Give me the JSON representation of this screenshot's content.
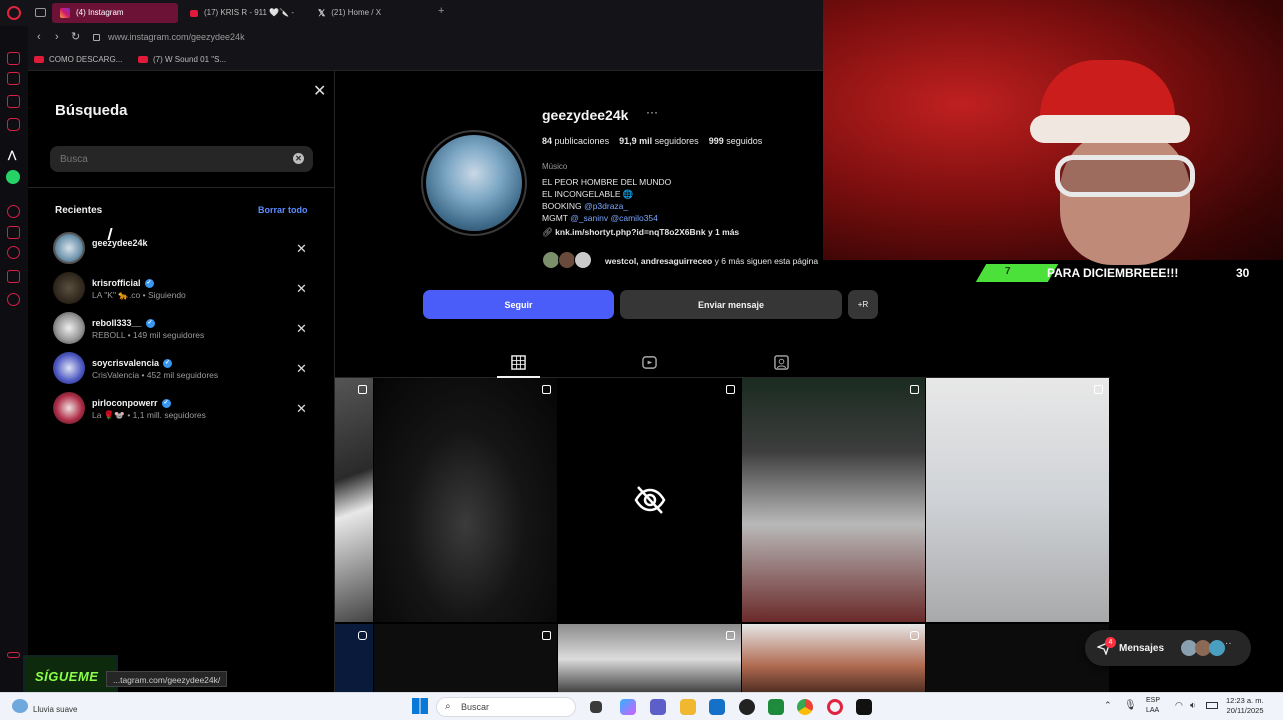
{
  "browser": {
    "tabs": [
      {
        "label": "(4) Instagram",
        "active": true
      },
      {
        "label": "(17) KRIS R - 911 🤍🔪 -",
        "active": false
      },
      {
        "label": "(21) Home / X",
        "active": false
      }
    ],
    "url": "www.instagram.com/geezydee24k",
    "bookmarks": [
      "COMO DESCARG...",
      "(7) W Sound 01 \"S..."
    ],
    "status_url": "...tagram.com/geezydee24k/"
  },
  "search_panel": {
    "title": "Búsqueda",
    "placeholder": "Busca",
    "clear_glyph": "✕",
    "recents_label": "Recientes",
    "clear_all": "Borrar todo",
    "close_glyph": "✕",
    "items": [
      {
        "username": "geezydee24k",
        "verified": false,
        "subtitle": ""
      },
      {
        "username": "krisrofficial",
        "verified": true,
        "subtitle": "LA \"K\" 🐆.co • Siguiendo"
      },
      {
        "username": "reboll333__",
        "verified": true,
        "subtitle": "REBOLL • 149 mil seguidores"
      },
      {
        "username": "soycrisvalencia",
        "verified": true,
        "subtitle": "CrisValencia • 452 mil seguidores"
      },
      {
        "username": "pirloconpowerr",
        "verified": true,
        "subtitle": "La 🌹🐭 • 1,1 mill. seguidores"
      }
    ]
  },
  "profile": {
    "handle": "geezydee24k",
    "more": "···",
    "posts_count": "84",
    "posts_label": "publicaciones",
    "followers_count": "91,9 mil",
    "followers_label": "seguidores",
    "following_count": "999",
    "following_label": "seguidos",
    "category": "Músico",
    "bio_lines": [
      "EL PEOR HOMBRE DEL MUNDO",
      "EL INCONGELABLE 🌐"
    ],
    "booking_label": "BOOKING",
    "booking_handle": "@p3draza_",
    "mgmt_label": "MGMT",
    "mgmt_handle1": "@_saninv",
    "mgmt_handle2": "@camilo354",
    "link": "knk.im/shortyt.php?id=nqT8o2X6Bnk y 1 más",
    "followed_by_names": "westcol, andresaguirreceo",
    "followed_by_rest": "y 6 más siguen esta página",
    "follow_button": "Seguir",
    "message_button": "Enviar mensaje",
    "add_button": "+R"
  },
  "overlay": {
    "goal_number": "7",
    "goal_text": "PARA DICIEMBREEE!!!",
    "goal_count": "30",
    "sigueme": "SÍGUEME"
  },
  "messages": {
    "label": "Mensajes",
    "badge": "4"
  },
  "taskbar": {
    "search": "Buscar",
    "weather": "Lluvia suave",
    "lang1": "ESP",
    "lang2": "LAA",
    "time": "12:23 a. m.",
    "date": "20/11/2025"
  },
  "colors": {
    "accent": "#4a5df9",
    "link": "#7aa7ff",
    "tab_active": "#6b1236",
    "goal_green": "#4be03a"
  }
}
